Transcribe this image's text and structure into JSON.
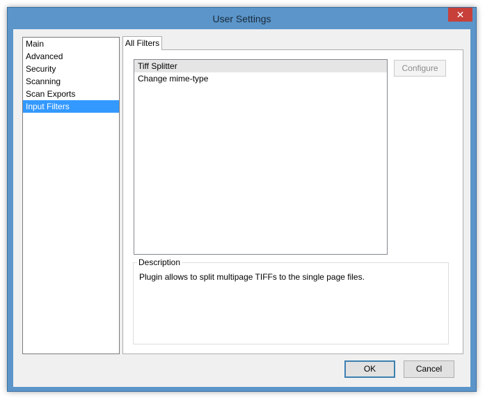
{
  "window": {
    "title": "User Settings",
    "close_glyph": "✕"
  },
  "nav": {
    "items": [
      {
        "label": "Main"
      },
      {
        "label": "Advanced"
      },
      {
        "label": "Security"
      },
      {
        "label": "Scanning"
      },
      {
        "label": "Scan Exports"
      },
      {
        "label": "Input Filters"
      }
    ],
    "selected": "Input Filters"
  },
  "tabs": [
    {
      "label": "All Filters"
    }
  ],
  "filters": {
    "items": [
      {
        "label": "Tiff Splitter"
      },
      {
        "label": "Change mime-type"
      }
    ],
    "selected": "Tiff Splitter"
  },
  "configure_label": "Configure",
  "description": {
    "legend": "Description",
    "text": "Plugin allows to split multipage TIFFs to the single page files."
  },
  "buttons": {
    "ok": "OK",
    "cancel": "Cancel"
  },
  "colors": {
    "titlebar": "#5b95c9",
    "close": "#c7403a",
    "selection": "#3399ff"
  }
}
